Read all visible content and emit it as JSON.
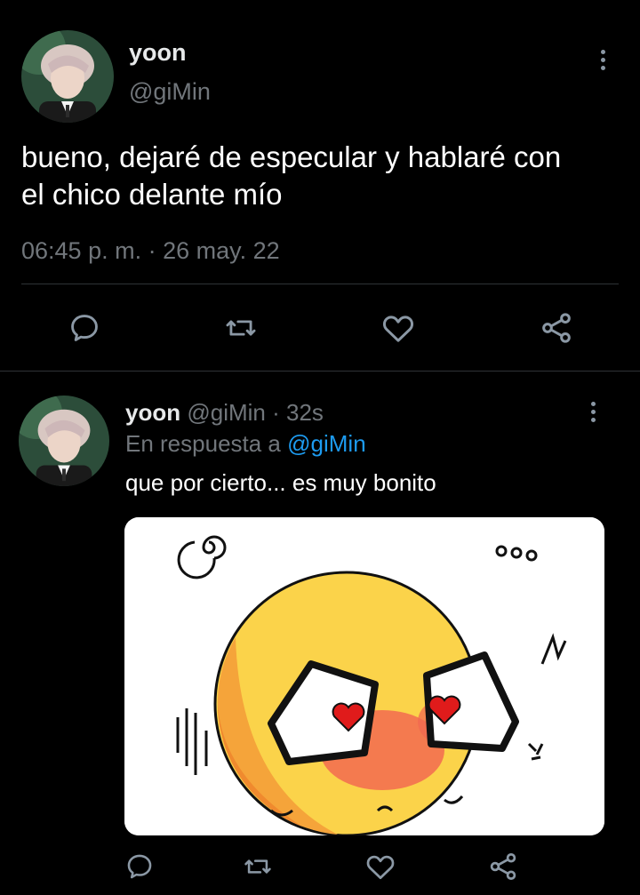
{
  "main_tweet": {
    "author_name": "yoon",
    "author_handle": "@giMin",
    "text_line1": "bueno, dejaré de especular y hablaré con",
    "text_line2": "el chico delante mío",
    "timestamp": "06:45 p. m. · 26 may. 22",
    "actions": [
      "reply-icon",
      "retweet-icon",
      "like-icon",
      "share-icon"
    ]
  },
  "reply_tweet": {
    "author_name": "yoon",
    "author_handle": "@giMin",
    "time_ago": "· 32s",
    "reply_prefix": "En respuesta a",
    "reply_to": "@giMin",
    "text": "que por cierto... es muy bonito",
    "image_desc": "emoji-illustration",
    "actions": [
      "reply-icon",
      "retweet-icon",
      "like-icon",
      "share-icon"
    ]
  },
  "colors": {
    "background": "#000000",
    "text": "#e7e9ea",
    "secondary": "#71767b",
    "link": "#1d9bf0",
    "divider": "#2f3336"
  }
}
